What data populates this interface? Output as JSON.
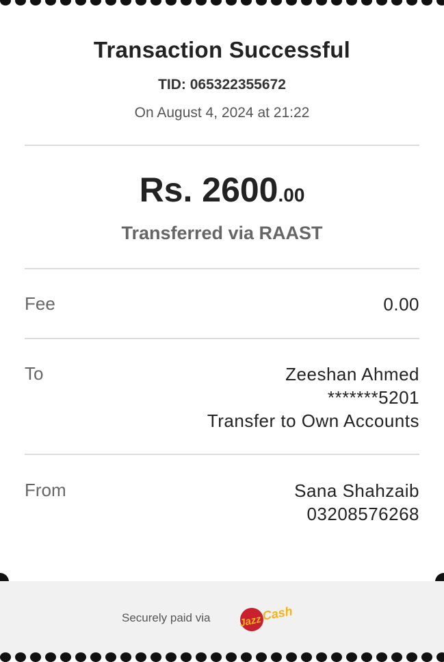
{
  "receipt": {
    "title": "Transaction Successful",
    "tid": "TID: 065322355672",
    "date": "On August 4, 2024 at 21:22",
    "amount_main": "Rs. 2600",
    "amount_decimal": ".00",
    "transfer_method": "Transferred via RAAST"
  },
  "details": {
    "fee_label": "Fee",
    "fee_value": "0.00",
    "to_label": "To",
    "to_name": "Zeeshan Ahmed",
    "to_account": "*******5201",
    "to_note": "Transfer to Own Accounts",
    "from_label": "From",
    "from_name": "Sana Shahzaib",
    "from_account": "03208576268"
  },
  "footer": {
    "text": "Securely paid via",
    "logo_text_left": "Jazz",
    "logo_text_right": "Cash",
    "logo_colors": {
      "red": "#c8202f",
      "yellow": "#f4b21b"
    }
  }
}
